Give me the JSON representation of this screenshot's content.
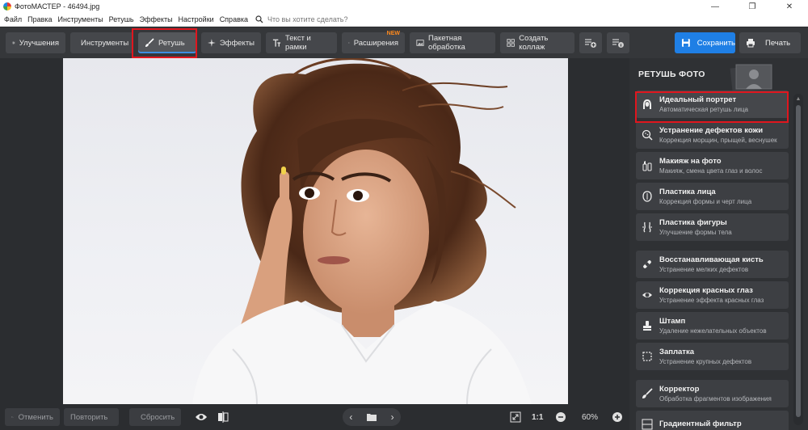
{
  "window": {
    "title": "ФотоМАСТЕР - 46494.jpg",
    "minimize": "—",
    "maximize": "❐",
    "close": "✕"
  },
  "menu": {
    "items": [
      "Файл",
      "Правка",
      "Инструменты",
      "Ретушь",
      "Эффекты",
      "Настройки",
      "Справка"
    ],
    "search_placeholder": "Что вы хотите сделать?"
  },
  "toolbar": {
    "tabs": [
      {
        "label": "Улучшения",
        "icon": "sliders-icon"
      },
      {
        "label": "Инструменты",
        "icon": "crop-icon"
      },
      {
        "label": "Ретушь",
        "icon": "brush-icon",
        "active": true
      },
      {
        "label": "Эффекты",
        "icon": "sparkle-icon"
      },
      {
        "label": "Текст и рамки",
        "icon": "text-icon"
      },
      {
        "label": "Расширения",
        "icon": "plus-icon",
        "badge": "NEW"
      },
      {
        "label": "Пакетная обработка",
        "icon": "images-icon"
      },
      {
        "label": "Создать коллаж",
        "icon": "collage-icon"
      }
    ],
    "save_label": "Сохранить",
    "print_label": "Печать"
  },
  "bottom": {
    "undo_label": "Отменить",
    "redo_label": "Повторить",
    "reset_label": "Сбросить",
    "zoom_ratio": "1:1",
    "zoom_level": "60%"
  },
  "panel": {
    "title": "РЕТУШЬ ФОТО",
    "items": [
      {
        "title": "Идеальный портрет",
        "desc": "Автоматическая ретушь лица",
        "icon": "portrait-icon"
      },
      {
        "title": "Устранение дефектов кожи",
        "desc": "Коррекция морщин, прыщей, веснушек",
        "icon": "skin-icon"
      },
      {
        "title": "Макияж на фото",
        "desc": "Макияж, смена цвета глаз и волос",
        "icon": "makeup-icon"
      },
      {
        "title": "Пластика лица",
        "desc": "Коррекция формы и черт лица",
        "icon": "face-shape-icon"
      },
      {
        "title": "Пластика фигуры",
        "desc": "Улучшение формы тела",
        "icon": "body-shape-icon"
      },
      {
        "title": "Восстанавливающая кисть",
        "desc": "Устранение мелких дефектов",
        "icon": "bandage-icon"
      },
      {
        "title": "Коррекция красных глаз",
        "desc": "Устранение эффекта красных глаз",
        "icon": "eye-icon"
      },
      {
        "title": "Штамп",
        "desc": "Удаление нежелательных объектов",
        "icon": "stamp-icon"
      },
      {
        "title": "Заплатка",
        "desc": "Устранение крупных дефектов",
        "icon": "patch-icon"
      },
      {
        "title": "Корректор",
        "desc": "Обработка фрагментов изображения",
        "icon": "corrector-icon"
      },
      {
        "title": "Градиентный фильтр",
        "desc": "",
        "icon": "gradient-icon"
      }
    ]
  },
  "colors": {
    "accent": "#1f7fe5",
    "highlight": "#e0161e",
    "new_badge": "#ff8a1e"
  }
}
